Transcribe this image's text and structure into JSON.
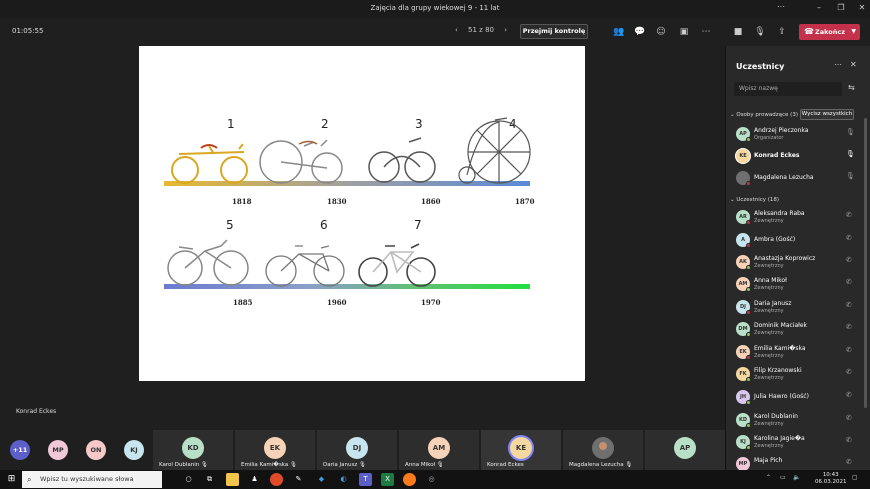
{
  "window": {
    "title": "Zajęcia dla grupy wiekowej 9 - 11 lat"
  },
  "toolbar": {
    "timer": "01:05:55",
    "page": "51 z 80",
    "take_control": "Przejmij kontrolę",
    "end_label": "Zakończ"
  },
  "slide": {
    "numbers": [
      "1",
      "2",
      "3",
      "4",
      "5",
      "6",
      "7"
    ],
    "years": [
      "1818",
      "1830",
      "1860",
      "1870",
      "1885",
      "1960",
      "1970"
    ]
  },
  "stage": {
    "presenter": "Konrad Eckes"
  },
  "strip": {
    "more": "+11",
    "small": [
      "MP",
      "ON",
      "KJ"
    ],
    "tiles": [
      {
        "initials": "KD",
        "name": "Karol Dublanin",
        "color": "#b8e0c8"
      },
      {
        "initials": "EK",
        "name": "Emilia Kami�ska",
        "color": "#f6d2b8"
      },
      {
        "initials": "DJ",
        "name": "Daria Janusz",
        "color": "#c7e5ee"
      },
      {
        "initials": "AM",
        "name": "Anna Mikoł",
        "color": "#f6d2b8"
      },
      {
        "initials": "KE",
        "name": "Konrad Eckes",
        "color": "#f5d7a0"
      },
      {
        "initials": "",
        "name": "Magdalena Lezucha",
        "color": "#6f6f6f"
      },
      {
        "initials": "AP",
        "name": "",
        "color": "#b8e0c8"
      }
    ]
  },
  "panel": {
    "title": "Uczestnicy",
    "search_placeholder": "Wpisz nazwę",
    "presenters_label": "Osoby prowadzące (3)",
    "mute_all": "Wycisz wszystkich",
    "attendees_label": "Uczestnicy (18)",
    "presenters": [
      {
        "initials": "AP",
        "name": "Andrzej Pieczonka",
        "role": "Organizator",
        "color": "#b8e0c8"
      },
      {
        "initials": "KE",
        "name": "Konrad Eckes",
        "role": "",
        "color": "#f5d7a0"
      },
      {
        "initials": "ML",
        "name": "Magdalena Lezucha",
        "role": "",
        "color": "#6f6f6f"
      }
    ],
    "attendees": [
      {
        "initials": "AR",
        "name": "Aleksandra Raba",
        "role": "Zewnętrzny",
        "color": "#b8e0c8"
      },
      {
        "initials": "A",
        "name": "Ambra (Gość)",
        "role": "",
        "color": "#c7e5ee"
      },
      {
        "initials": "AK",
        "name": "Anastazja Koprowicz",
        "role": "Zewnętrzny",
        "color": "#f6d2b8"
      },
      {
        "initials": "AM",
        "name": "Anna Mikoł",
        "role": "Zewnętrzny",
        "color": "#f6d2b8"
      },
      {
        "initials": "DJ",
        "name": "Daria Janusz",
        "role": "Zewnętrzny",
        "color": "#c7e5ee"
      },
      {
        "initials": "DM",
        "name": "Dominik Maciałek",
        "role": "Zewnętrzny",
        "color": "#b8e0c8"
      },
      {
        "initials": "EK",
        "name": "Emilia Kami�ska",
        "role": "Zewnętrzny",
        "color": "#f6d2b8"
      },
      {
        "initials": "FK",
        "name": "Filip Krzanowski",
        "role": "Zewnętrzny",
        "color": "#f5d7a0"
      },
      {
        "initials": "JH",
        "name": "Julia Hawro (Gość)",
        "role": "",
        "color": "#d8c8ee"
      },
      {
        "initials": "KD",
        "name": "Karol Dublanin",
        "role": "Zewnętrzny",
        "color": "#b8e0c8"
      },
      {
        "initials": "KJ",
        "name": "Karolina Jagie�a",
        "role": "Zewnętrzny",
        "color": "#b8e0c8"
      },
      {
        "initials": "MP",
        "name": "Maja Pich",
        "role": "",
        "color": "#f0c8d8"
      }
    ]
  },
  "taskbar": {
    "search_placeholder": "Wpisz tu wyszukiwane słowa",
    "time": "10:43",
    "date": "06.03.2021"
  }
}
